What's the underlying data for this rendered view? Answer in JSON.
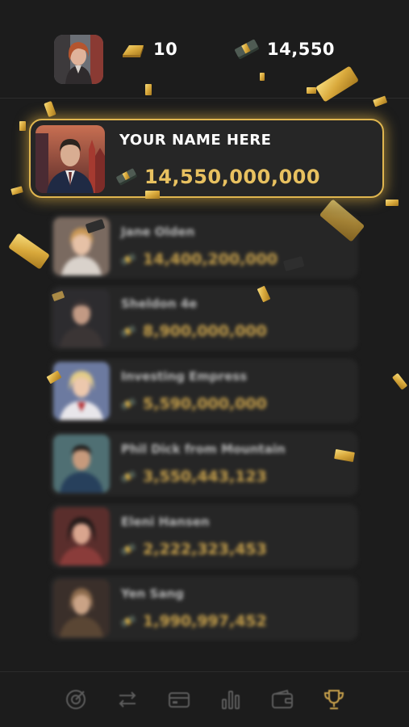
{
  "header": {
    "gold_count": "10",
    "cash_count": "14,550",
    "gold_icon": "gold-bar-icon",
    "cash_icon": "money-stack-icon"
  },
  "player": {
    "name": "YOUR NAME HERE",
    "net_worth": "14,550,000,000"
  },
  "leaderboard": [
    {
      "name": "Jane Olden",
      "net_worth": "14,400,200,000"
    },
    {
      "name": "Sheldon 4e",
      "net_worth": "8,900,000,000"
    },
    {
      "name": "Investing Empress",
      "net_worth": "5,590,000,000"
    },
    {
      "name": "Phil Dick from Mountain",
      "net_worth": "3,550,443,123"
    },
    {
      "name": "Eleni Hansen",
      "net_worth": "2,222,323,453"
    },
    {
      "name": "Yen Sang",
      "net_worth": "1,990,997,452"
    }
  ],
  "bottom_nav": [
    {
      "icon": "target-icon",
      "active": false
    },
    {
      "icon": "transfer-arrows-icon",
      "active": false
    },
    {
      "icon": "card-icon",
      "active": false
    },
    {
      "icon": "bar-chart-icon",
      "active": false
    },
    {
      "icon": "wallet-icon",
      "active": false
    },
    {
      "icon": "trophy-icon",
      "active": true
    }
  ],
  "colors": {
    "background": "#1c1c1c",
    "card": "#262626",
    "gold": "#e0b64f",
    "worth_text": "#e8c160",
    "nav_inactive": "#5c5c5c"
  }
}
